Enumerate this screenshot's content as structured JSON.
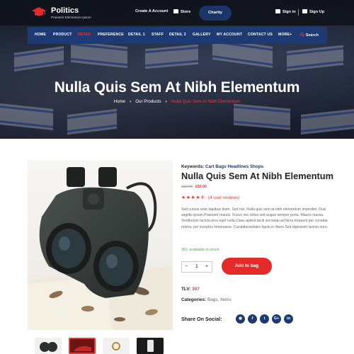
{
  "brand": {
    "name": "Politics",
    "tagline": "Praesent Elementum Ipsum"
  },
  "topbar": {
    "create_account": "Create A Account",
    "store": "Store",
    "charity": "Charity",
    "sign_in": "Sign in",
    "sign_up": "Sign Up"
  },
  "nav": {
    "items": [
      "HOME",
      "PRODUCT",
      "DETAIL",
      "PREFERENCE",
      "DETAIL 1",
      "STAFF",
      "DETAIL 2",
      "GALLERY",
      "MY ACCOUNT",
      "CONTACT US",
      "MORE+"
    ],
    "active": "DETAIL",
    "search": "Search"
  },
  "hero": {
    "title": "Nulla Quis Sem At Nibh Elementum",
    "breadcrumb": {
      "home": "Home",
      "parent": "Our Products",
      "current": "Nulla Quis Sem At Nibh Elementum"
    }
  },
  "product": {
    "keywords_label": "Keywords:",
    "keywords_value": "Cart Bags Headlines Shops",
    "title": "Nulla Quis Sem At Nibh Elementum",
    "old_price": "£19.00",
    "new_price": "£50.00",
    "rating": 4.5,
    "stars": "★★★★⯪",
    "reviews": "(4 user reviews)",
    "description": "Sed cursus ante dapibus diam. Sed nisi. Nulla quis sem at nibh elementum imperdiet. Duis sagittis ipsum.Praesent mauris. Fusce nec tellus sed augue semper porta. Mauris massa. Vestibulum lacinia arcu eget nulla.Class aptent taciti sociosqu ad litora torquent per conubia nostra, per inceptos himenaeos. Curabitursodales ligula in libero.Sed dignissim lacinia nunc.",
    "stock": "361 available in stock",
    "qty": {
      "minus": "−",
      "value": "1",
      "plus": "+"
    },
    "add_to_bag": "Add to bag",
    "tlv_label": "TLV:",
    "tlv_value": "307",
    "categories_label": "Categories:",
    "categories_value": "Bags, Items",
    "share_label": "Share On Social:",
    "social": [
      "rss-icon",
      "facebook-icon",
      "twitter-icon",
      "google-plus-icon",
      "linkedin-icon"
    ],
    "social_glyphs": [
      "◉",
      "f",
      "t",
      "G+",
      "in"
    ]
  },
  "colors": {
    "accent": "#e52a2a",
    "nav": "#1d3a73",
    "topbar": "#10131c"
  }
}
